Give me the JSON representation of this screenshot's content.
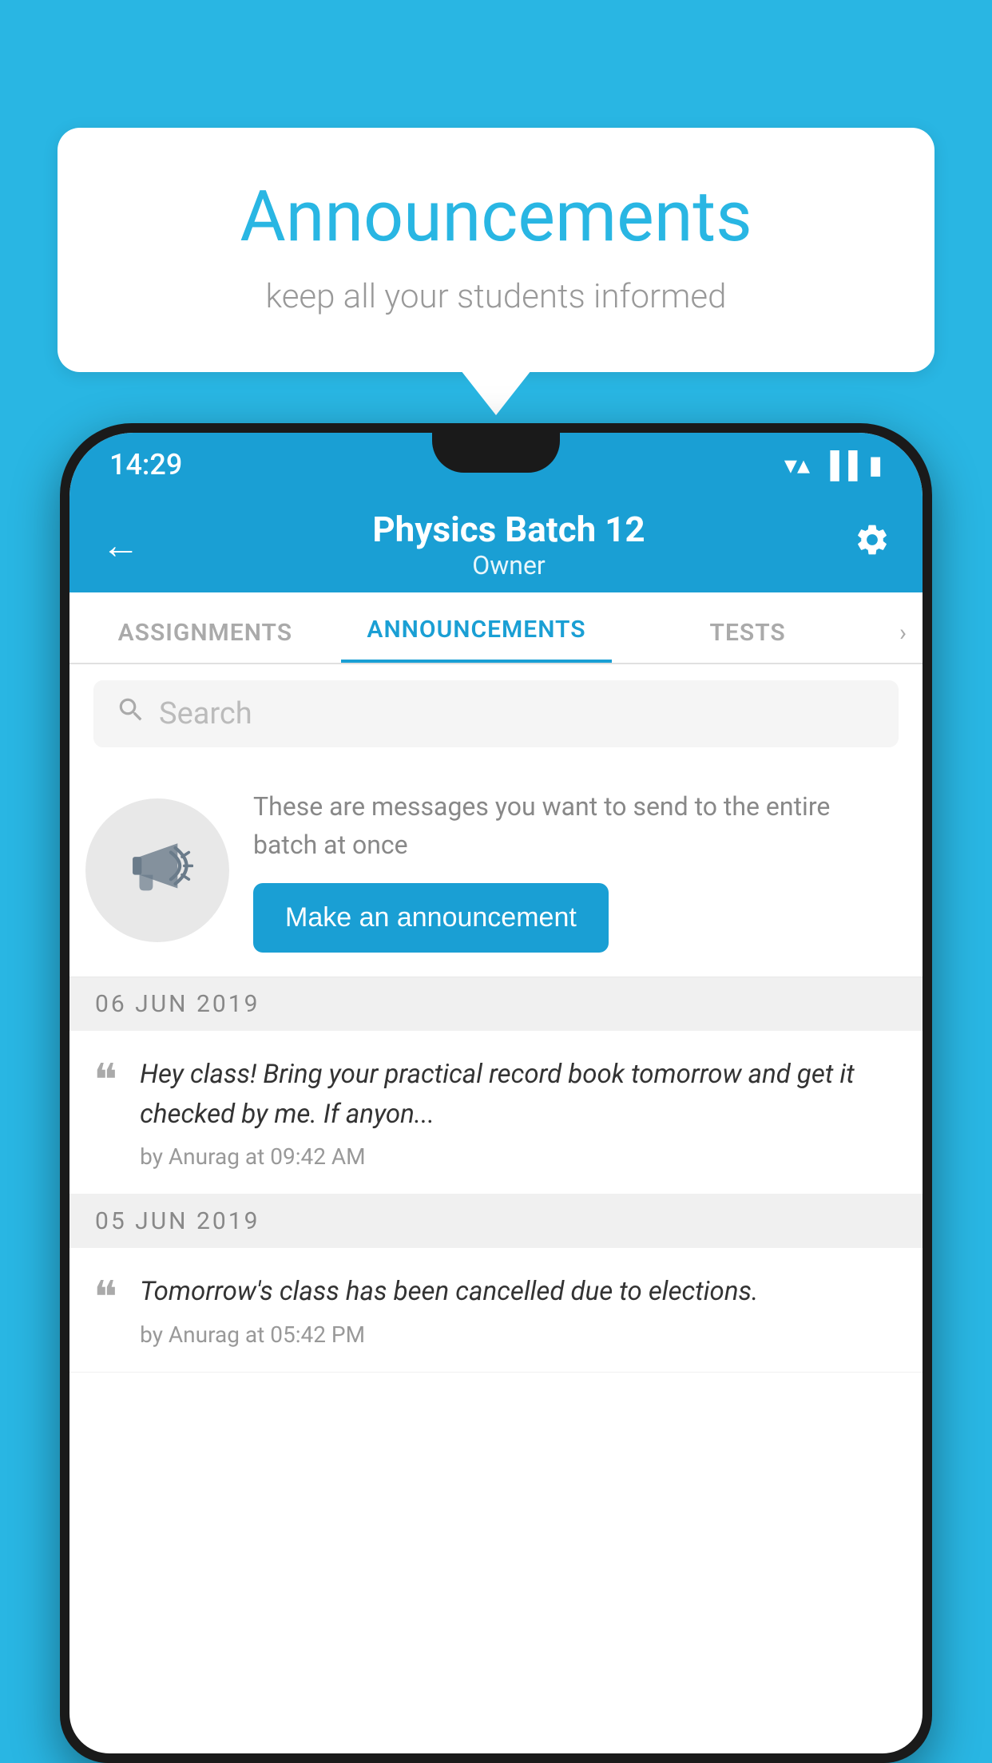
{
  "background_color": "#29b6e3",
  "speech_bubble": {
    "title": "Announcements",
    "subtitle": "keep all your students informed"
  },
  "status_bar": {
    "time": "14:29",
    "wifi": "▲",
    "signal": "▲",
    "battery": "▪"
  },
  "app_bar": {
    "title": "Physics Batch 12",
    "subtitle": "Owner",
    "back_label": "←"
  },
  "tabs": [
    {
      "label": "ASSIGNMENTS",
      "active": false
    },
    {
      "label": "ANNOUNCEMENTS",
      "active": true
    },
    {
      "label": "TESTS",
      "active": false
    }
  ],
  "search": {
    "placeholder": "Search"
  },
  "promo": {
    "description": "These are messages you want to send to the entire batch at once",
    "button_label": "Make an announcement"
  },
  "announcements": [
    {
      "date": "06  JUN  2019",
      "message": "Hey class! Bring your practical record book tomorrow and get it checked by me. If anyon...",
      "meta": "by Anurag at 09:42 AM"
    },
    {
      "date": "05  JUN  2019",
      "message": "Tomorrow's class has been cancelled due to elections.",
      "meta": "by Anurag at 05:42 PM"
    }
  ]
}
